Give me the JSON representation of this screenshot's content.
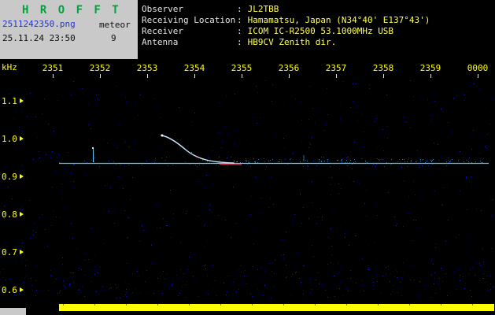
{
  "header": {
    "title": "H R O F F T",
    "filename": "2511242350.png",
    "mode": "meteor",
    "datetime": "25.11.24 23:50",
    "count": "9",
    "sep": ":",
    "info": [
      {
        "label": "Observer",
        "value": "JL2TBB"
      },
      {
        "label": "Receiving Location",
        "value": "Hamamatsu, Japan (N34°40' E137°43')"
      },
      {
        "label": "Receiver",
        "value": "ICOM IC-R2500 53.1000MHz USB"
      },
      {
        "label": "Antenna",
        "value": "HB9CV Zenith dir."
      }
    ]
  },
  "chart_data": {
    "type": "heatmap",
    "title": "HROFFT 10-minute meteor radio echo spectrogram",
    "x_axis_unit": "time (HHMM)",
    "y_axis_unit_label": "kHz",
    "x_tick_labels": [
      "2351",
      "2352",
      "2353",
      "2354",
      "2355",
      "2356",
      "2357",
      "2358",
      "2359",
      "0000"
    ],
    "y_tick_labels": [
      "1.1",
      "1.0",
      "0.9",
      "0.8",
      "0.7",
      "0.6"
    ],
    "y_range_khz": [
      0.55,
      1.15
    ],
    "carrier_line_khz": 0.93,
    "events": [
      {
        "kind": "meteor echo with decaying doppler tail",
        "time_hhmm": "2353-2354",
        "freq_khz_from": 1.03,
        "freq_khz_to": 0.93
      },
      {
        "kind": "brief echo",
        "time_hhmm": "2351.8",
        "freq_khz": 0.96
      },
      {
        "kind": "faint echo",
        "time_hhmm": "2356.3",
        "freq_khz": 0.95
      }
    ],
    "legend": "off",
    "grid": "off"
  },
  "colors": {
    "panel_gray": "#c9c9c9",
    "title_green": "#00a23c",
    "filename_blue": "#2433cc",
    "axis_yellow": "#ffff00",
    "info_label_white": "#e2e2e2",
    "info_value_yellow": "#ffff55",
    "carrier_cyan": "#28c8f2",
    "noise_blue": "#0a0aa0",
    "echo_trace": "#c8ecff",
    "echo_red": "#e03050",
    "level_bar_yellow": "#ffff00"
  }
}
